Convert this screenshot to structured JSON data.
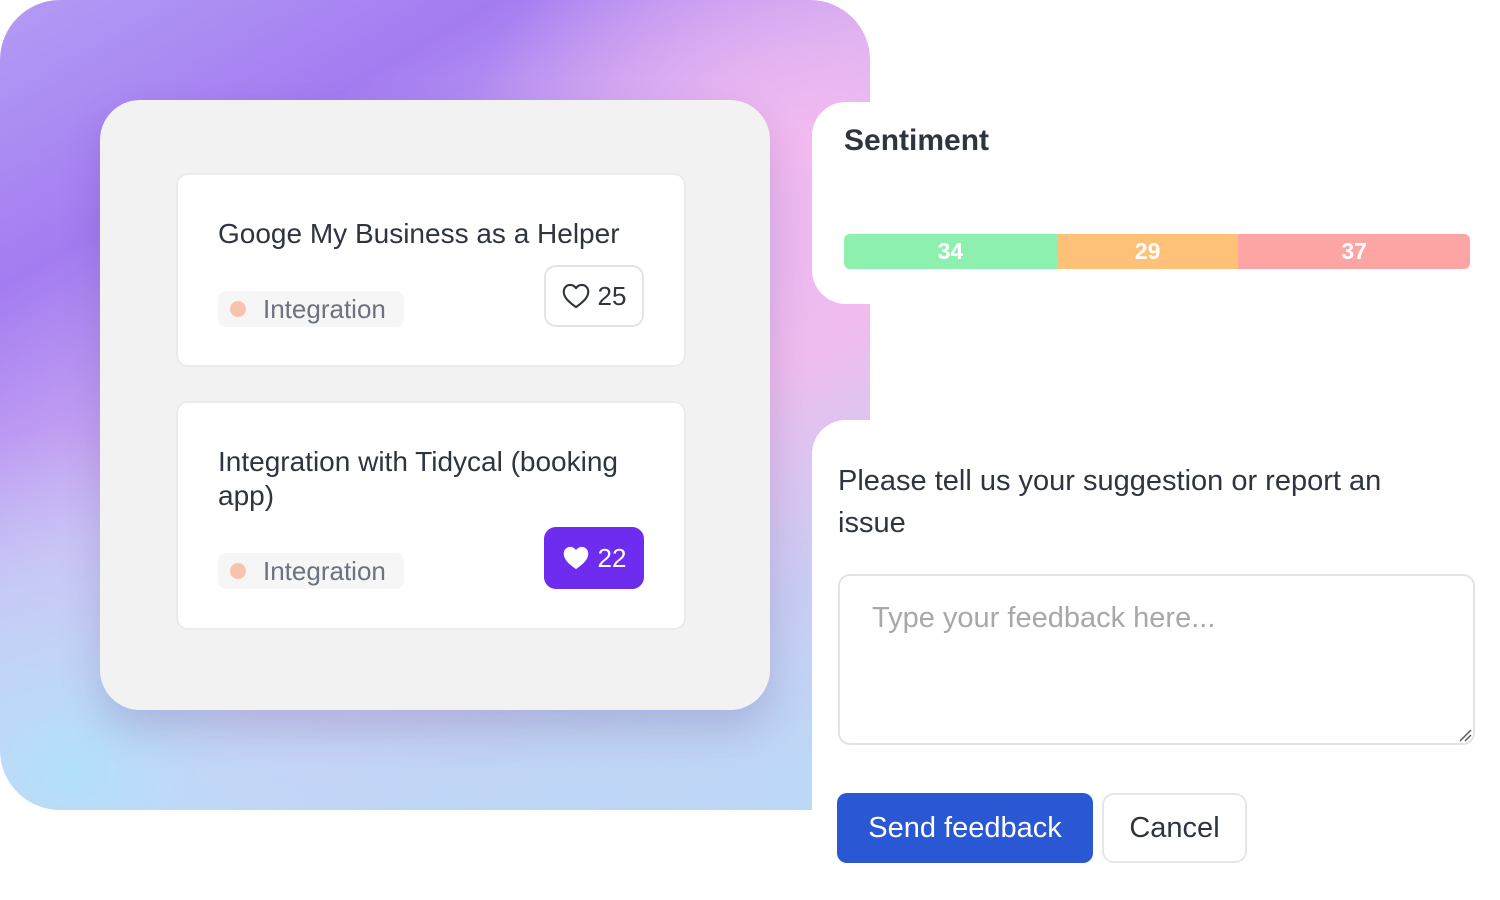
{
  "ideas": [
    {
      "title": "Googe My Business as a Helper",
      "tag": "Integration",
      "votes": "25",
      "voted": false
    },
    {
      "title": "Integration with Tidycal (booking app)",
      "tag": "Integration",
      "votes": "22",
      "voted": true
    }
  ],
  "sentiment": {
    "title": "Sentiment",
    "segments": [
      {
        "value": 34,
        "label": "34",
        "color": "#8ef0ae"
      },
      {
        "value": 29,
        "label": "29",
        "color": "#fdc178"
      },
      {
        "value": 37,
        "label": "37",
        "color": "#fca5a4"
      }
    ]
  },
  "feedback": {
    "prompt": "Please tell us your suggestion or report an issue",
    "placeholder": "Type your feedback here...",
    "value": "",
    "send_label": "Send feedback",
    "cancel_label": "Cancel"
  },
  "colors": {
    "accent": "#6d2cee",
    "primary_button": "#2a58d4",
    "tag_dot": "#f7c3ad"
  },
  "icons": {
    "vote": "heart-icon",
    "resize": "resize-grip-icon"
  }
}
